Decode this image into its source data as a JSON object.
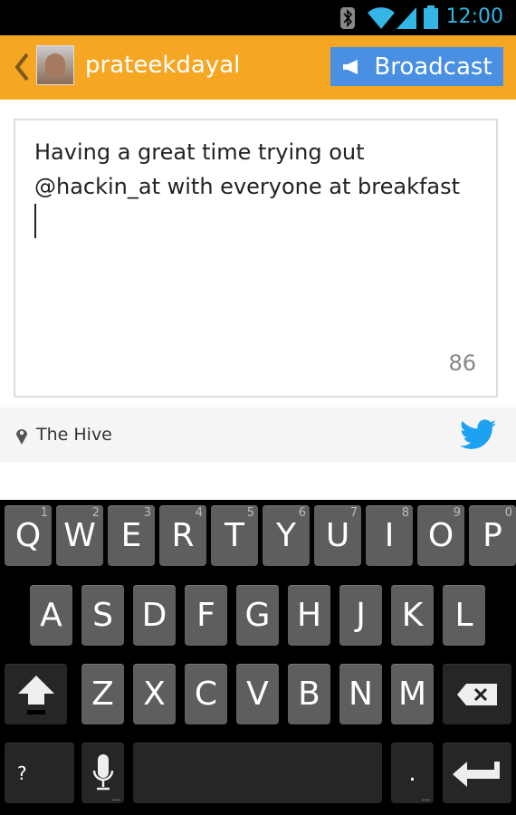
{
  "status_bar": {
    "time": "12:00",
    "icons": [
      "bluetooth-icon",
      "wifi-icon",
      "signal-icon",
      "battery-icon"
    ],
    "time_color": "#33b5e5"
  },
  "header": {
    "username": "prateekdayal",
    "broadcast_label": "Broadcast",
    "background": "#f5a623",
    "button_color": "#4a90e2"
  },
  "compose": {
    "text_line1": "Having a great time trying out",
    "text_line2": "@hackin_at with everyone at breakfast",
    "remaining_chars": "86"
  },
  "location": {
    "name": "The Hive",
    "twitter_color": "#1da1f2"
  },
  "keyboard": {
    "row1": [
      {
        "k": "Q",
        "n": "1"
      },
      {
        "k": "W",
        "n": "2"
      },
      {
        "k": "E",
        "n": "3"
      },
      {
        "k": "R",
        "n": "4"
      },
      {
        "k": "T",
        "n": "5"
      },
      {
        "k": "Y",
        "n": "6"
      },
      {
        "k": "U",
        "n": "7"
      },
      {
        "k": "I",
        "n": "8"
      },
      {
        "k": "O",
        "n": "9"
      },
      {
        "k": "P",
        "n": "0"
      }
    ],
    "row2": [
      "A",
      "S",
      "D",
      "F",
      "G",
      "H",
      "J",
      "K",
      "L"
    ],
    "row3": [
      "Z",
      "X",
      "C",
      "V",
      "B",
      "N",
      "M"
    ],
    "symbols_key": "?",
    "period_key": "."
  }
}
